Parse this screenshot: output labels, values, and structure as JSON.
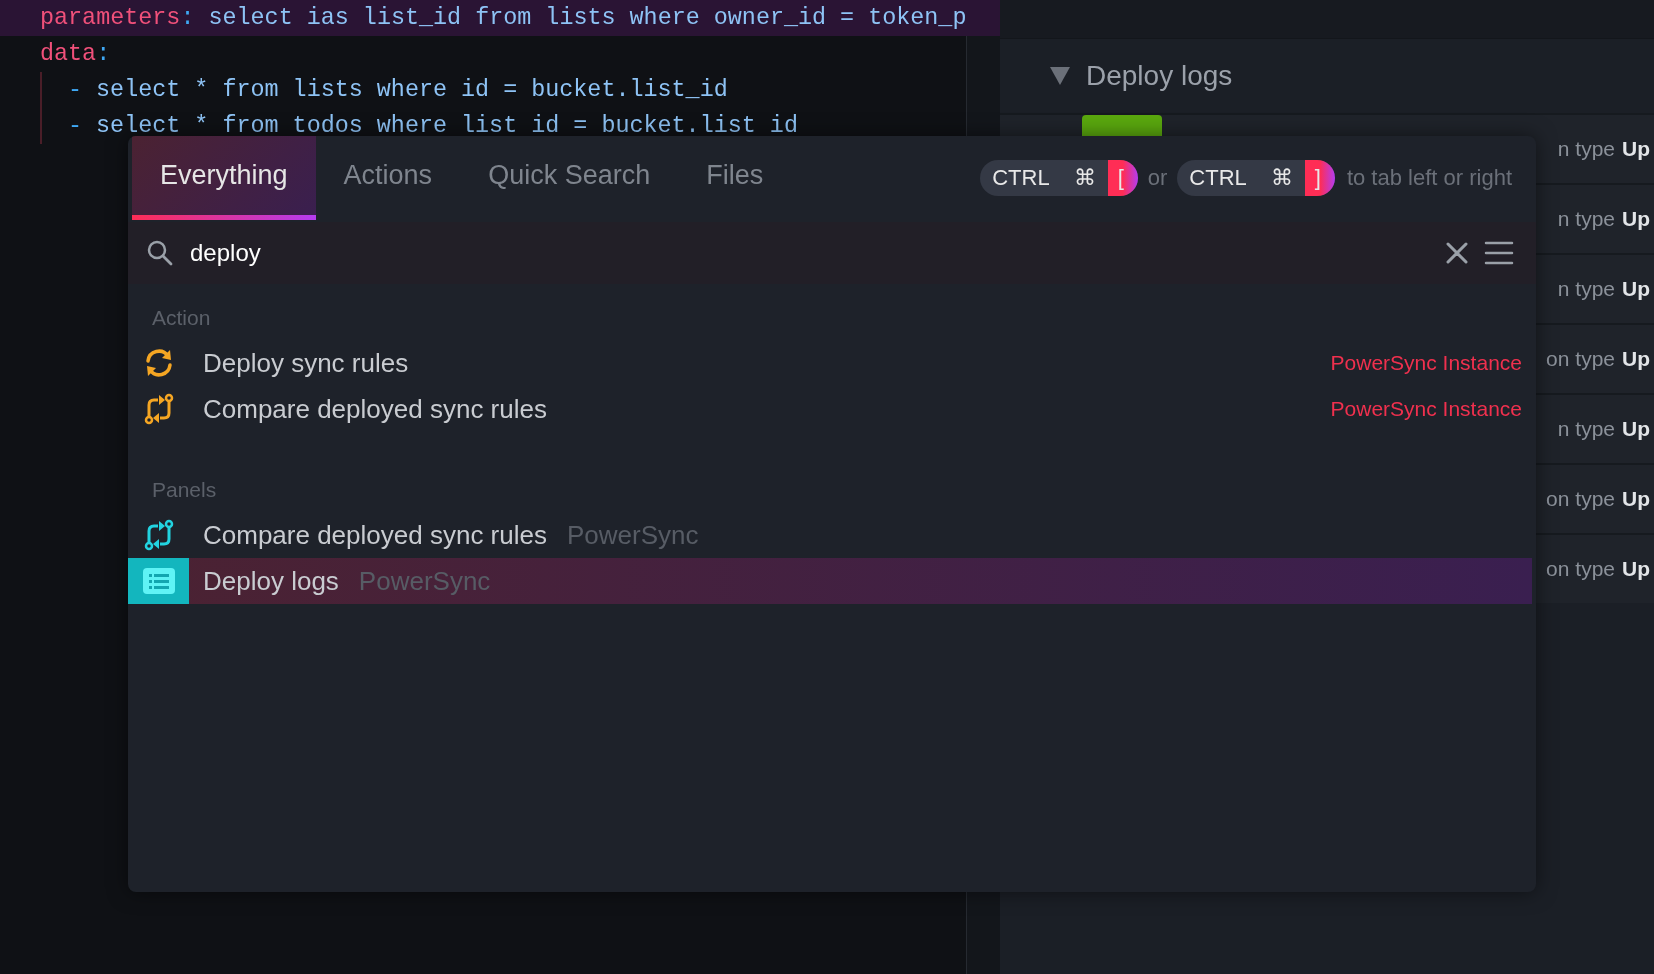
{
  "editor": {
    "lines": [
      {
        "highlighted": true,
        "tokens": [
          {
            "kind": "key",
            "text": "parameters"
          },
          {
            "kind": "punct",
            "text": ":"
          },
          {
            "kind": "code",
            "text": " select ias list_id from lists where owner_id = token_p"
          }
        ]
      },
      {
        "highlighted": false,
        "tokens": [
          {
            "kind": "key",
            "text": "data"
          },
          {
            "kind": "punct",
            "text": ":"
          }
        ],
        "children": [
          {
            "highlighted": false,
            "tokens": [
              {
                "kind": "dash",
                "text": "-"
              },
              {
                "kind": "code",
                "text": " select * from lists where id = bucket.list_id"
              }
            ]
          },
          {
            "highlighted": false,
            "tokens": [
              {
                "kind": "dash",
                "text": "-"
              },
              {
                "kind": "code",
                "text": " select * from todos where list id = bucket.list id"
              }
            ]
          }
        ]
      }
    ]
  },
  "panel": {
    "title": "Deploy logs",
    "expanded": true,
    "rows": [
      {
        "text": "n type",
        "value": "Up"
      },
      {
        "text": "n type",
        "value": "Up"
      },
      {
        "text": "n type",
        "value": "Up"
      },
      {
        "text": "on type",
        "value": "Up"
      },
      {
        "text": "n type",
        "value": "Up"
      },
      {
        "text": "on type",
        "value": "Up"
      },
      {
        "text": "on type",
        "value": "Up"
      }
    ]
  },
  "palette": {
    "tabs": [
      {
        "label": "Everything",
        "selected": true
      },
      {
        "label": "Actions",
        "selected": false
      },
      {
        "label": "Quick Search",
        "selected": false
      },
      {
        "label": "Files",
        "selected": false
      }
    ],
    "shortcuts": [
      {
        "keys": [
          "CTRL",
          "⌘",
          "["
        ]
      },
      {
        "keys": [
          "CTRL",
          "⌘",
          "]"
        ]
      }
    ],
    "shortcut_separator": "or",
    "shortcut_hint": "to tab left or right",
    "search": {
      "value": "deploy"
    },
    "groups": [
      {
        "title": "Action",
        "kind": "action",
        "items": [
          {
            "kind": "refresh",
            "label": "Deploy sync rules",
            "source": "PowerSync Instance",
            "selected": false
          },
          {
            "kind": "compare",
            "label": "Compare deployed sync rules",
            "source": "PowerSync Instance",
            "selected": false
          }
        ]
      },
      {
        "title": "Panels",
        "kind": "panel",
        "items": [
          {
            "kind": "compare",
            "label": "Compare deployed sync rules",
            "source": "PowerSync",
            "selected": false
          },
          {
            "kind": "list",
            "label": "Deploy logs",
            "source": "PowerSync",
            "selected": true
          }
        ]
      }
    ]
  }
}
